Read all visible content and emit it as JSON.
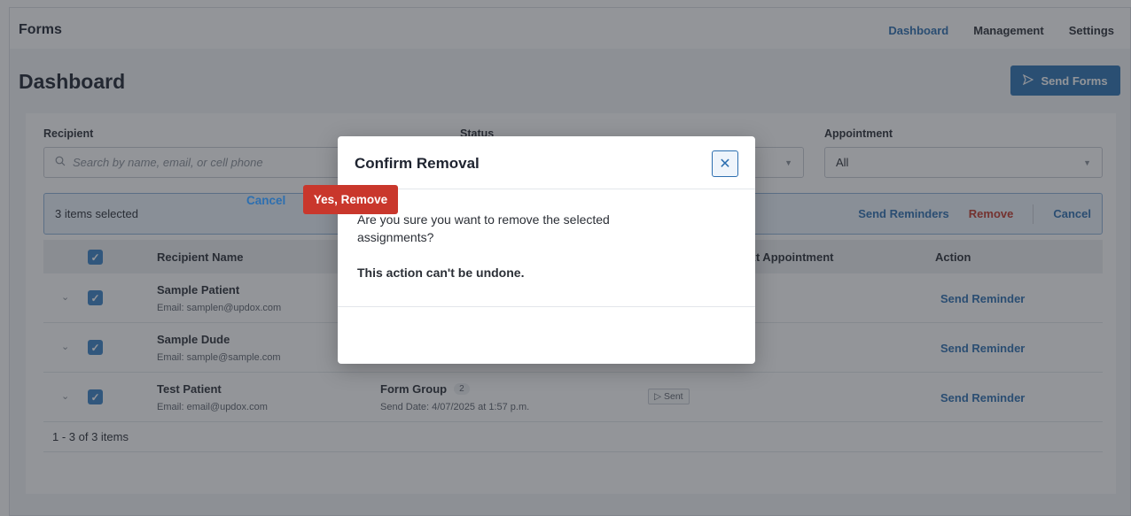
{
  "app": {
    "brand": "Forms",
    "nav": [
      {
        "label": "Dashboard",
        "active": true
      },
      {
        "label": "Management",
        "active": false
      },
      {
        "label": "Settings",
        "active": false
      }
    ]
  },
  "page": {
    "title": "Dashboard",
    "send_forms_label": "Send Forms",
    "send_forms_icon": "send-icon"
  },
  "filters": {
    "recipient_label": "Recipient",
    "search_placeholder": "Search by name, email, or cell phone",
    "status_label": "Status",
    "appointment_label": "Appointment",
    "appointment_value": "All"
  },
  "selection_bar": {
    "count_text": "3 items selected",
    "send_reminders": "Send Reminders",
    "remove": "Remove",
    "cancel": "Cancel"
  },
  "table": {
    "headers": {
      "recipient": "Recipient Name",
      "next_appointment": "Next Appointment",
      "action": "Action"
    },
    "rows": [
      {
        "name": "Sample Patient",
        "email": "Email: samplen@updox.com",
        "form_group": "",
        "badge": "",
        "send_date": "",
        "status": "",
        "action": "Send Reminder",
        "checked": true
      },
      {
        "name": "Sample Dude",
        "email": "Email: sample@sample.com",
        "form_group": "",
        "badge": "",
        "send_date": "",
        "status": "",
        "action": "Send Reminder",
        "checked": true
      },
      {
        "name": "Test Patient",
        "email": "Email: email@updox.com",
        "form_group": "Form Group",
        "badge": "2",
        "send_date": "Send Date: 4/07/2025 at 1:57 p.m.",
        "status": "Sent",
        "action": "Send Reminder",
        "checked": true
      }
    ],
    "pagination": "1 - 3 of 3 items"
  },
  "modal": {
    "title": "Confirm Removal",
    "question": "Are you sure you want to remove the selected assignments?",
    "warning": "This action can't be undone.",
    "cancel_label": "Cancel",
    "confirm_label": "Yes, Remove"
  },
  "colors": {
    "accent": "#2d6fb0",
    "danger": "#c9372c",
    "overlay": "rgba(40,44,52,0.5)"
  }
}
